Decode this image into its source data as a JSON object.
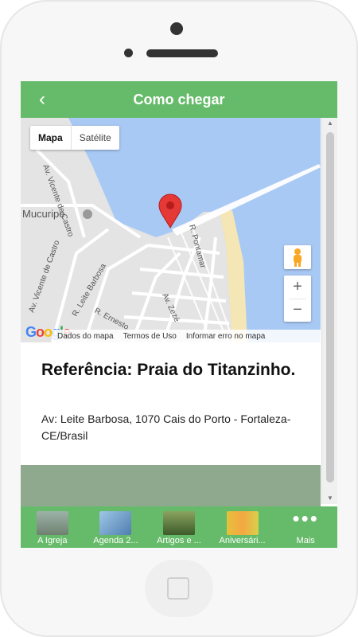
{
  "header": {
    "title": "Como chegar",
    "back_icon": "chevron-left-icon"
  },
  "map": {
    "type_control": {
      "map_label": "Mapa",
      "satellite_label": "Satélite"
    },
    "labels": {
      "castro_top": "Av. Vicente de Castro",
      "mucuripe": "Mucuripe",
      "vicente": "Av. Vicente de Castro",
      "leite": "R. Leite Barbosa",
      "ernesto": "R. Ernesto",
      "pontamar": "R. Pontamar",
      "zeze": "Av. Zezé"
    },
    "footer": {
      "data_label": "Dados do mapa",
      "terms_label": "Termos de Uso",
      "report_label": "Informar erro no mapa"
    },
    "logo": "Google"
  },
  "info": {
    "reference": "Referência: Praia do Titanzinho.",
    "address": "Av: Leite Barbosa, 1070 Cais do Porto - Fortaleza-CE/Brasil"
  },
  "tabs": [
    {
      "label": "A Igreja",
      "color": "#8a9a86"
    },
    {
      "label": "Agenda 2...",
      "color": "#7aa3c7"
    },
    {
      "label": "Artigos e ...",
      "color": "#5c7a4a"
    },
    {
      "label": "Aniversári...",
      "color": "#d8c24a"
    },
    {
      "label": "Mais",
      "icon": "more-dots-icon"
    }
  ],
  "colors": {
    "accent": "#66bb6a",
    "water": "#a9c9f5",
    "land": "#e4e4e4",
    "beach": "#f5e6b6",
    "pin": "#e53935"
  }
}
